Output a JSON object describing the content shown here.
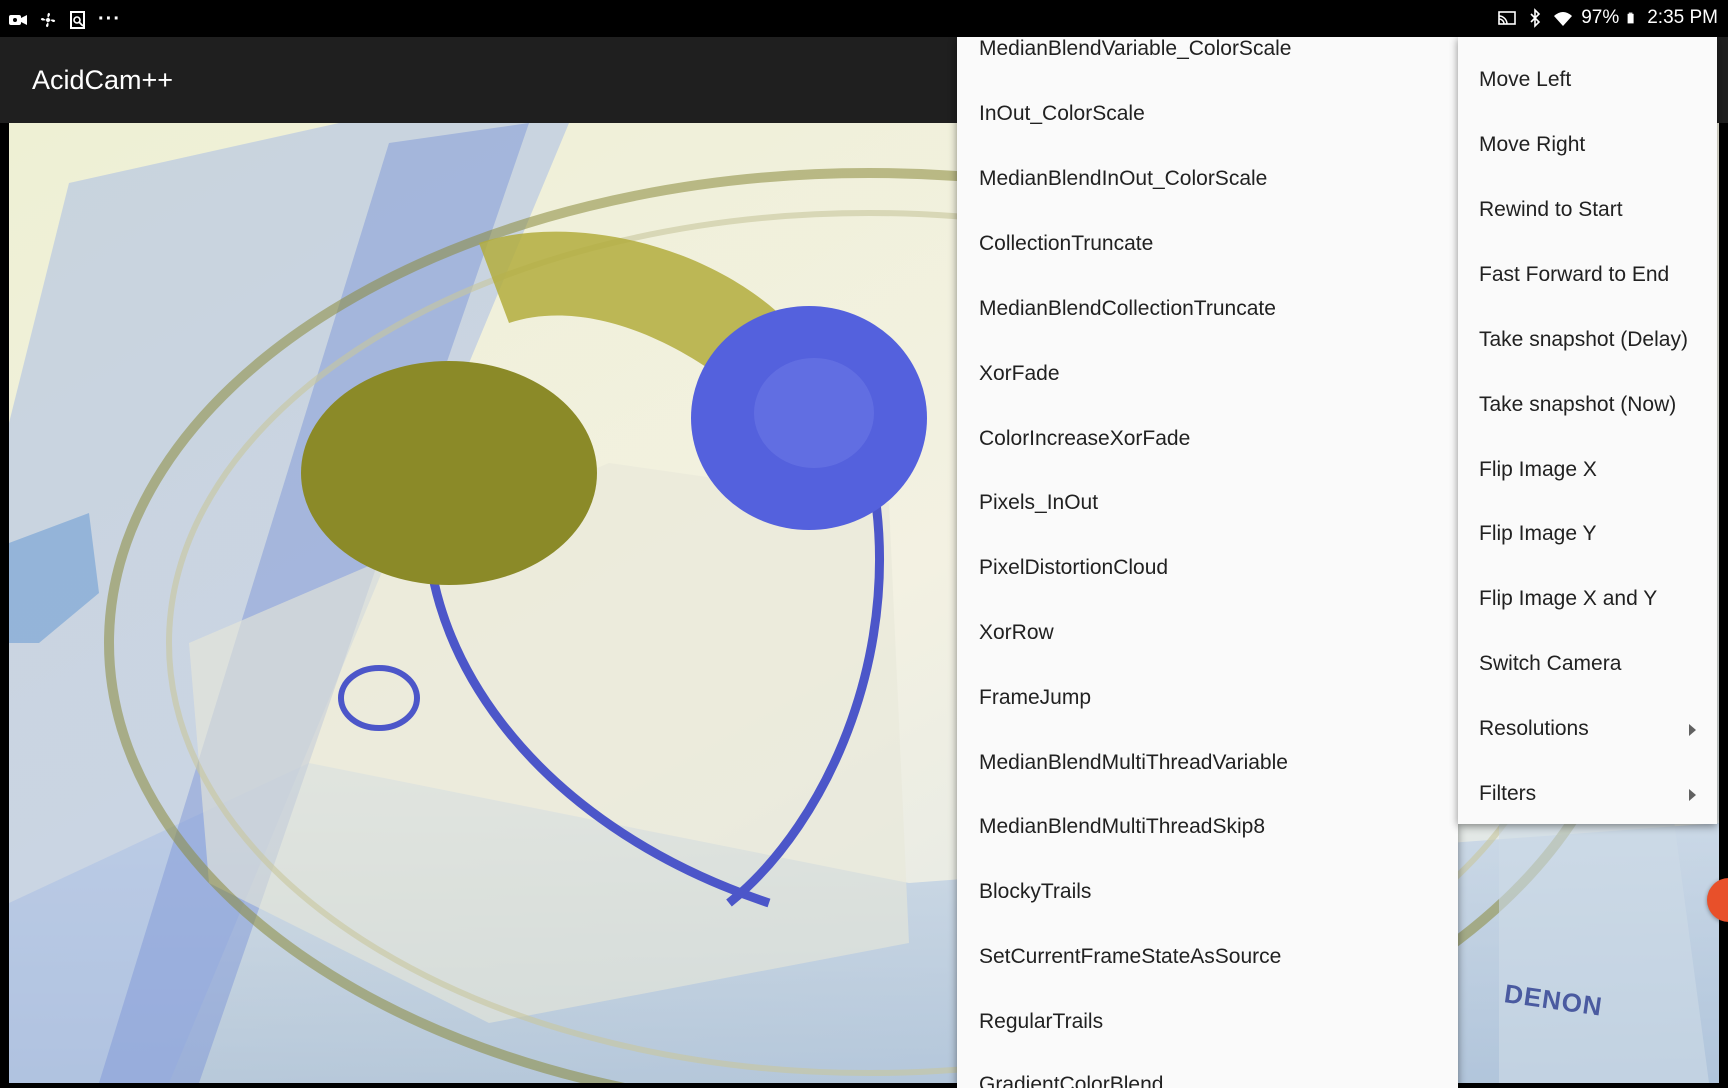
{
  "status_bar": {
    "icons_left": [
      "video-camera-icon",
      "fan-icon",
      "screenshot-icon",
      "more-icon"
    ],
    "more_glyph": "···",
    "icons_right": [
      "cast-icon",
      "bluetooth-icon",
      "wifi-icon",
      "battery-icon"
    ],
    "battery": "97%",
    "time": "2:35 PM"
  },
  "app_bar": {
    "title": "AcidCam++"
  },
  "preview": {
    "brand_text": "DENON"
  },
  "filter_menu": {
    "items": [
      "MedianBlendVariable_ColorScale",
      "InOut_ColorScale",
      "MedianBlendInOut_ColorScale",
      "CollectionTruncate",
      "MedianBlendCollectionTruncate",
      "XorFade",
      "ColorIncreaseXorFade",
      "Pixels_InOut",
      "PixelDistortionCloud",
      "XorRow",
      "FrameJump",
      "MedianBlendMultiThreadVariable",
      "MedianBlendMultiThreadSkip8",
      "BlockyTrails",
      "SetCurrentFrameStateAsSource",
      "RegularTrails",
      "GradientColorBlend"
    ]
  },
  "overflow_menu": {
    "items": [
      {
        "label": "Move Left"
      },
      {
        "label": "Move Right"
      },
      {
        "label": "Rewind to Start"
      },
      {
        "label": "Fast Forward to End"
      },
      {
        "label": "Take snapshot (Delay)"
      },
      {
        "label": "Take snapshot (Now)"
      },
      {
        "label": "Flip Image X"
      },
      {
        "label": "Flip Image Y"
      },
      {
        "label": "Flip Image X and Y"
      },
      {
        "label": "Switch Camera"
      },
      {
        "label": "Resolutions",
        "submenu": true
      },
      {
        "label": "Filters",
        "submenu": true
      }
    ]
  }
}
